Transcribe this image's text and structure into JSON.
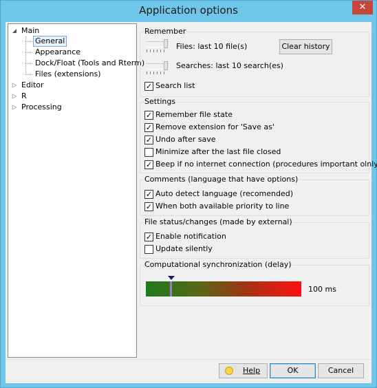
{
  "window": {
    "title": "Application options",
    "close_label": "✕"
  },
  "tree": {
    "items": [
      {
        "label": "Main",
        "expanded": true
      },
      {
        "label": "General",
        "selected": true
      },
      {
        "label": "Appearance"
      },
      {
        "label": "Dock/Float (Tools and Rterm)"
      },
      {
        "label": "Files (extensions)"
      },
      {
        "label": "Editor",
        "expanded": false
      },
      {
        "label": "R",
        "expanded": false
      },
      {
        "label": "Processing",
        "expanded": false
      }
    ]
  },
  "remember": {
    "title": "Remember",
    "files_label": "Files: last 10 file(s)",
    "files_value": 10,
    "searches_label": "Searches: last 10 search(es)",
    "searches_value": 10,
    "clear_history_label": "Clear history",
    "search_list": {
      "label": "Search list",
      "checked": true
    }
  },
  "settings": {
    "title": "Settings",
    "options": [
      {
        "label": "Remember file state",
        "checked": true
      },
      {
        "label": "Remove extension for 'Save as'",
        "checked": true
      },
      {
        "label": "Undo after save",
        "checked": true
      },
      {
        "label": "Minimize after the last file closed",
        "checked": false
      },
      {
        "label": "Beep if no internet connection (procedures important olnly)",
        "checked": true
      }
    ]
  },
  "comments": {
    "title": "Comments (language that have options)",
    "options": [
      {
        "label": "Auto detect language (recomended)",
        "checked": true
      },
      {
        "label": "When both available priority to line",
        "checked": true
      }
    ]
  },
  "file_status": {
    "title": "File status/changes (made by external)",
    "options": [
      {
        "label": "Enable notification",
        "checked": true
      },
      {
        "label": "Update silently",
        "checked": false
      }
    ]
  },
  "sync": {
    "title": "Computational synchronization (delay)",
    "value_label": "100 ms",
    "value_ms": 100
  },
  "buttons": {
    "help": "Help",
    "ok": "OK",
    "cancel": "Cancel"
  },
  "colors": {
    "titlebar": "#6fc6e8",
    "close": "#c7463b",
    "sync_start": "#1e7a1e",
    "sync_end": "#ff1010"
  }
}
